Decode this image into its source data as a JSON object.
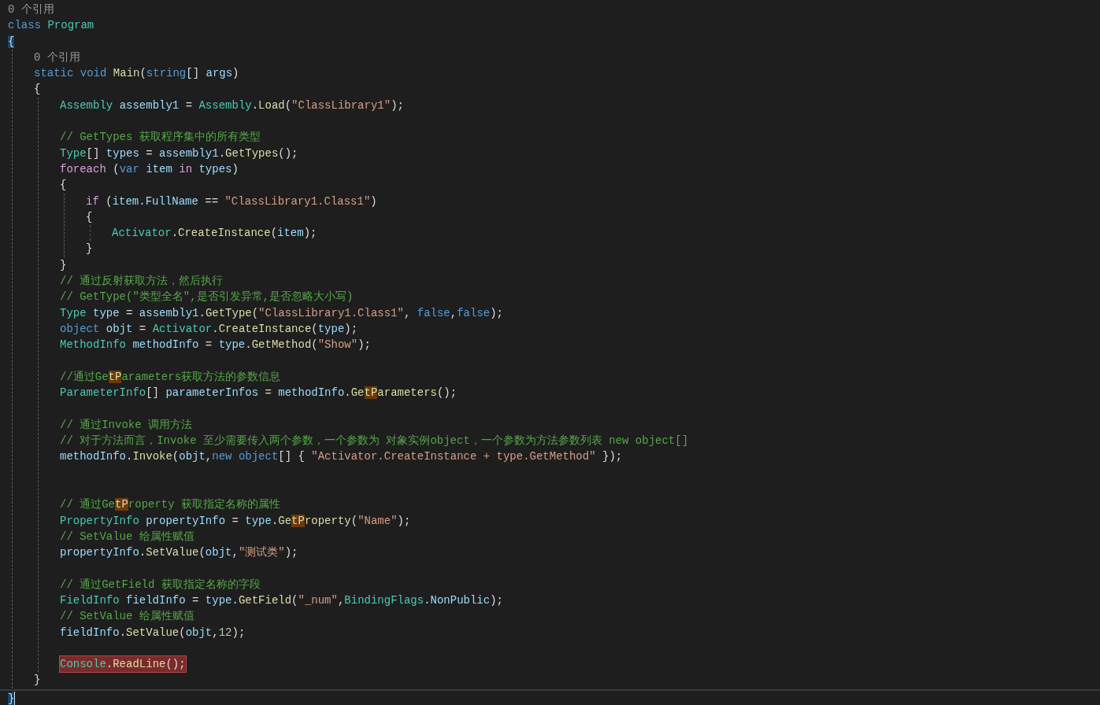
{
  "code": [
    {
      "kind": "codelens",
      "text": "0 个引用"
    },
    {
      "kind": "line",
      "tokens": [
        {
          "kind": "keyword",
          "text": "class "
        },
        {
          "kind": "type",
          "text": "Program"
        }
      ]
    },
    {
      "kind": "line",
      "tokens": [
        {
          "kind": "brace_match",
          "text": "{"
        }
      ]
    },
    {
      "kind": "block",
      "children": [
        {
          "kind": "codelens",
          "text": "0 个引用"
        },
        {
          "kind": "line",
          "tokens": [
            {
              "kind": "keyword",
              "text": "static "
            },
            {
              "kind": "keyword",
              "text": "void "
            },
            {
              "kind": "method",
              "text": "Main"
            },
            {
              "kind": "plain",
              "text": "("
            },
            {
              "kind": "keyword",
              "text": "string"
            },
            {
              "kind": "plain",
              "text": "[] "
            },
            {
              "kind": "variable",
              "text": "args"
            },
            {
              "kind": "plain",
              "text": ")"
            }
          ]
        },
        {
          "kind": "line",
          "tokens": [
            {
              "kind": "plain",
              "text": "{"
            }
          ]
        },
        {
          "kind": "block",
          "children": [
            {
              "kind": "line",
              "tokens": [
                {
                  "kind": "type",
                  "text": "Assembly "
                },
                {
                  "kind": "variable",
                  "text": "assembly1"
                },
                {
                  "kind": "plain",
                  "text": " = "
                },
                {
                  "kind": "type",
                  "text": "Assembly"
                },
                {
                  "kind": "plain",
                  "text": "."
                },
                {
                  "kind": "method",
                  "text": "Load"
                },
                {
                  "kind": "plain",
                  "text": "("
                },
                {
                  "kind": "string",
                  "text": "\"ClassLibrary1\""
                },
                {
                  "kind": "plain",
                  "text": ");"
                }
              ]
            },
            {
              "kind": "blank"
            },
            {
              "kind": "line",
              "tokens": [
                {
                  "kind": "comment",
                  "text": "// GetTypes 获取程序集中的所有类型"
                }
              ]
            },
            {
              "kind": "line",
              "tokens": [
                {
                  "kind": "type",
                  "text": "Type"
                },
                {
                  "kind": "plain",
                  "text": "[] "
                },
                {
                  "kind": "variable",
                  "text": "types"
                },
                {
                  "kind": "plain",
                  "text": " = "
                },
                {
                  "kind": "variable",
                  "text": "assembly1"
                },
                {
                  "kind": "plain",
                  "text": "."
                },
                {
                  "kind": "method",
                  "text": "GetTypes"
                },
                {
                  "kind": "plain",
                  "text": "();"
                }
              ]
            },
            {
              "kind": "line",
              "tokens": [
                {
                  "kind": "control",
                  "text": "foreach"
                },
                {
                  "kind": "plain",
                  "text": " ("
                },
                {
                  "kind": "keyword",
                  "text": "var "
                },
                {
                  "kind": "variable",
                  "text": "item "
                },
                {
                  "kind": "control",
                  "text": "in "
                },
                {
                  "kind": "variable",
                  "text": "types"
                },
                {
                  "kind": "plain",
                  "text": ")"
                }
              ]
            },
            {
              "kind": "line",
              "tokens": [
                {
                  "kind": "plain",
                  "text": "{"
                }
              ]
            },
            {
              "kind": "block",
              "children": [
                {
                  "kind": "line",
                  "tokens": [
                    {
                      "kind": "control",
                      "text": "if"
                    },
                    {
                      "kind": "plain",
                      "text": " ("
                    },
                    {
                      "kind": "variable",
                      "text": "item"
                    },
                    {
                      "kind": "plain",
                      "text": "."
                    },
                    {
                      "kind": "variable",
                      "text": "FullName"
                    },
                    {
                      "kind": "plain",
                      "text": " == "
                    },
                    {
                      "kind": "string",
                      "text": "\"ClassLibrary1.Class1\""
                    },
                    {
                      "kind": "plain",
                      "text": ")"
                    }
                  ]
                },
                {
                  "kind": "line",
                  "tokens": [
                    {
                      "kind": "plain",
                      "text": "{"
                    }
                  ]
                },
                {
                  "kind": "block",
                  "children": [
                    {
                      "kind": "line",
                      "tokens": [
                        {
                          "kind": "type",
                          "text": "Activator"
                        },
                        {
                          "kind": "plain",
                          "text": "."
                        },
                        {
                          "kind": "method",
                          "text": "CreateInstance"
                        },
                        {
                          "kind": "plain",
                          "text": "("
                        },
                        {
                          "kind": "variable",
                          "text": "item"
                        },
                        {
                          "kind": "plain",
                          "text": ");"
                        }
                      ]
                    }
                  ]
                },
                {
                  "kind": "line",
                  "tokens": [
                    {
                      "kind": "plain",
                      "text": "}"
                    }
                  ]
                }
              ]
            },
            {
              "kind": "line",
              "tokens": [
                {
                  "kind": "plain",
                  "text": "}"
                }
              ]
            },
            {
              "kind": "line",
              "tokens": [
                {
                  "kind": "comment",
                  "text": "// 通过反射获取方法，然后执行"
                }
              ]
            },
            {
              "kind": "line",
              "tokens": [
                {
                  "kind": "comment",
                  "text": "// GetType(\"类型全名\",是否引发异常,是否忽略大小写)"
                }
              ]
            },
            {
              "kind": "line",
              "tokens": [
                {
                  "kind": "type",
                  "text": "Type "
                },
                {
                  "kind": "variable",
                  "text": "type"
                },
                {
                  "kind": "plain",
                  "text": " = "
                },
                {
                  "kind": "variable",
                  "text": "assembly1"
                },
                {
                  "kind": "plain",
                  "text": "."
                },
                {
                  "kind": "method",
                  "text": "GetType"
                },
                {
                  "kind": "plain",
                  "text": "("
                },
                {
                  "kind": "string",
                  "text": "\"ClassLibrary1.Class1\""
                },
                {
                  "kind": "plain",
                  "text": ", "
                },
                {
                  "kind": "keyword",
                  "text": "false"
                },
                {
                  "kind": "plain",
                  "text": ","
                },
                {
                  "kind": "keyword",
                  "text": "false"
                },
                {
                  "kind": "plain",
                  "text": ");"
                }
              ]
            },
            {
              "kind": "line",
              "tokens": [
                {
                  "kind": "keyword",
                  "text": "object "
                },
                {
                  "kind": "variable",
                  "text": "objt"
                },
                {
                  "kind": "plain",
                  "text": " = "
                },
                {
                  "kind": "type",
                  "text": "Activator"
                },
                {
                  "kind": "plain",
                  "text": "."
                },
                {
                  "kind": "method",
                  "text": "CreateInstance"
                },
                {
                  "kind": "plain",
                  "text": "("
                },
                {
                  "kind": "variable",
                  "text": "type"
                },
                {
                  "kind": "plain",
                  "text": ");"
                }
              ]
            },
            {
              "kind": "line",
              "tokens": [
                {
                  "kind": "type",
                  "text": "MethodInfo "
                },
                {
                  "kind": "variable",
                  "text": "methodInfo"
                },
                {
                  "kind": "plain",
                  "text": " = "
                },
                {
                  "kind": "variable",
                  "text": "type"
                },
                {
                  "kind": "plain",
                  "text": "."
                },
                {
                  "kind": "method",
                  "text": "GetMethod"
                },
                {
                  "kind": "plain",
                  "text": "("
                },
                {
                  "kind": "string",
                  "text": "\"Show\""
                },
                {
                  "kind": "plain",
                  "text": ");"
                }
              ]
            },
            {
              "kind": "blank"
            },
            {
              "kind": "line",
              "tokens": [
                {
                  "kind": "comment",
                  "text": "//通过Ge"
                },
                {
                  "kind": "match",
                  "text": "tP"
                },
                {
                  "kind": "comment",
                  "text": "arameters获取方法的参数信息"
                }
              ]
            },
            {
              "kind": "line",
              "tokens": [
                {
                  "kind": "type",
                  "text": "ParameterInfo"
                },
                {
                  "kind": "plain",
                  "text": "[] "
                },
                {
                  "kind": "variable",
                  "text": "parameterInfos"
                },
                {
                  "kind": "plain",
                  "text": " = "
                },
                {
                  "kind": "variable",
                  "text": "methodInfo"
                },
                {
                  "kind": "plain",
                  "text": "."
                },
                {
                  "kind": "method",
                  "text": "Ge"
                },
                {
                  "kind": "match",
                  "text": "tP"
                },
                {
                  "kind": "method",
                  "text": "arameters"
                },
                {
                  "kind": "plain",
                  "text": "();"
                }
              ]
            },
            {
              "kind": "blank"
            },
            {
              "kind": "line",
              "tokens": [
                {
                  "kind": "comment",
                  "text": "// 通过Invoke 调用方法"
                }
              ]
            },
            {
              "kind": "line",
              "tokens": [
                {
                  "kind": "comment",
                  "text": "// 对于方法而言，Invoke 至少需要传入两个参数，一个参数为 对象实例object，一个参数为方法参数列表 new object[]"
                }
              ]
            },
            {
              "kind": "line",
              "tokens": [
                {
                  "kind": "variable",
                  "text": "methodInfo"
                },
                {
                  "kind": "plain",
                  "text": "."
                },
                {
                  "kind": "method",
                  "text": "Invoke"
                },
                {
                  "kind": "plain",
                  "text": "("
                },
                {
                  "kind": "variable",
                  "text": "objt"
                },
                {
                  "kind": "plain",
                  "text": ","
                },
                {
                  "kind": "keyword",
                  "text": "new "
                },
                {
                  "kind": "keyword",
                  "text": "object"
                },
                {
                  "kind": "plain",
                  "text": "[] { "
                },
                {
                  "kind": "string",
                  "text": "\"Activator.CreateInstance + type.GetMethod\""
                },
                {
                  "kind": "plain",
                  "text": " });"
                }
              ]
            },
            {
              "kind": "blank"
            },
            {
              "kind": "blank"
            },
            {
              "kind": "line",
              "tokens": [
                {
                  "kind": "comment",
                  "text": "// 通过Ge"
                },
                {
                  "kind": "match",
                  "text": "tP"
                },
                {
                  "kind": "comment",
                  "text": "roperty 获取指定名称的属性"
                }
              ]
            },
            {
              "kind": "line",
              "tokens": [
                {
                  "kind": "type",
                  "text": "PropertyInfo "
                },
                {
                  "kind": "variable",
                  "text": "propertyInfo"
                },
                {
                  "kind": "plain",
                  "text": " = "
                },
                {
                  "kind": "variable",
                  "text": "type"
                },
                {
                  "kind": "plain",
                  "text": "."
                },
                {
                  "kind": "method",
                  "text": "Ge"
                },
                {
                  "kind": "match",
                  "text": "tP"
                },
                {
                  "kind": "method",
                  "text": "roperty"
                },
                {
                  "kind": "plain",
                  "text": "("
                },
                {
                  "kind": "string",
                  "text": "\"Name\""
                },
                {
                  "kind": "plain",
                  "text": ");"
                }
              ]
            },
            {
              "kind": "line",
              "tokens": [
                {
                  "kind": "comment",
                  "text": "// SetValue 给属性赋值"
                }
              ]
            },
            {
              "kind": "line",
              "tokens": [
                {
                  "kind": "variable",
                  "text": "propertyInfo"
                },
                {
                  "kind": "plain",
                  "text": "."
                },
                {
                  "kind": "method",
                  "text": "SetValue"
                },
                {
                  "kind": "plain",
                  "text": "("
                },
                {
                  "kind": "variable",
                  "text": "objt"
                },
                {
                  "kind": "plain",
                  "text": ","
                },
                {
                  "kind": "string",
                  "text": "\"测试类\""
                },
                {
                  "kind": "plain",
                  "text": ");"
                }
              ]
            },
            {
              "kind": "blank"
            },
            {
              "kind": "line",
              "tokens": [
                {
                  "kind": "comment",
                  "text": "// 通过GetField 获取指定名称的字段"
                }
              ]
            },
            {
              "kind": "line",
              "tokens": [
                {
                  "kind": "type",
                  "text": "FieldInfo "
                },
                {
                  "kind": "variable",
                  "text": "fieldInfo"
                },
                {
                  "kind": "plain",
                  "text": " = "
                },
                {
                  "kind": "variable",
                  "text": "type"
                },
                {
                  "kind": "plain",
                  "text": "."
                },
                {
                  "kind": "method",
                  "text": "GetField"
                },
                {
                  "kind": "plain",
                  "text": "("
                },
                {
                  "kind": "string",
                  "text": "\"_num\""
                },
                {
                  "kind": "plain",
                  "text": ","
                },
                {
                  "kind": "type",
                  "text": "BindingFlags"
                },
                {
                  "kind": "plain",
                  "text": "."
                },
                {
                  "kind": "variable",
                  "text": "NonPublic"
                },
                {
                  "kind": "plain",
                  "text": ");"
                }
              ]
            },
            {
              "kind": "line",
              "tokens": [
                {
                  "kind": "comment",
                  "text": "// SetValue 给属性赋值"
                }
              ]
            },
            {
              "kind": "line",
              "tokens": [
                {
                  "kind": "variable",
                  "text": "fieldInfo"
                },
                {
                  "kind": "plain",
                  "text": "."
                },
                {
                  "kind": "method",
                  "text": "SetValue"
                },
                {
                  "kind": "plain",
                  "text": "("
                },
                {
                  "kind": "variable",
                  "text": "objt"
                },
                {
                  "kind": "plain",
                  "text": ","
                },
                {
                  "kind": "number",
                  "text": "12"
                },
                {
                  "kind": "plain",
                  "text": ");"
                }
              ]
            },
            {
              "kind": "blank"
            },
            {
              "kind": "breakpoint",
              "tokens": [
                {
                  "kind": "type",
                  "text": "Console"
                },
                {
                  "kind": "plain",
                  "text": "."
                },
                {
                  "kind": "method",
                  "text": "ReadLine"
                },
                {
                  "kind": "plain",
                  "text": "();"
                }
              ]
            }
          ]
        },
        {
          "kind": "line",
          "tokens": [
            {
              "kind": "plain",
              "text": "}"
            }
          ]
        }
      ]
    },
    {
      "kind": "caret_line",
      "tokens": [
        {
          "kind": "brace_match",
          "text": "}"
        }
      ]
    }
  ]
}
